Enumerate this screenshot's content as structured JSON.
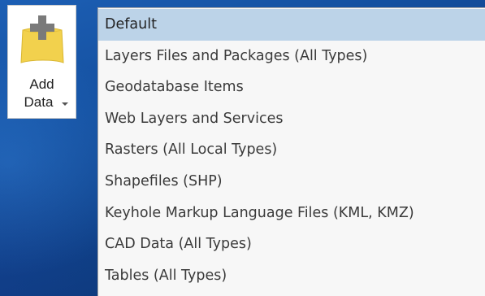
{
  "add_data_button": {
    "icon": "add-data-icon",
    "label_line1": "Add",
    "label_line2": "Data",
    "dropdown_icon": "chevron-down-icon"
  },
  "menu": {
    "items": [
      {
        "label": "Default",
        "selected": true
      },
      {
        "label": "Layers Files and Packages (All Types)"
      },
      {
        "label": "Geodatabase Items"
      },
      {
        "label": "Web Layers and Services"
      },
      {
        "label": "Rasters (All Local Types)"
      },
      {
        "label": "Shapefiles (SHP)"
      },
      {
        "label": "Keyhole Markup Language Files (KML, KMZ)"
      },
      {
        "label": "CAD Data (All Types)"
      },
      {
        "label": "Tables (All Types)"
      }
    ]
  },
  "colors": {
    "selected_bg": "#bcd3e8",
    "menu_bg": "#f7f7f7",
    "icon_yellow": "#f2d14d",
    "desktop_blue": "#1450a0"
  }
}
